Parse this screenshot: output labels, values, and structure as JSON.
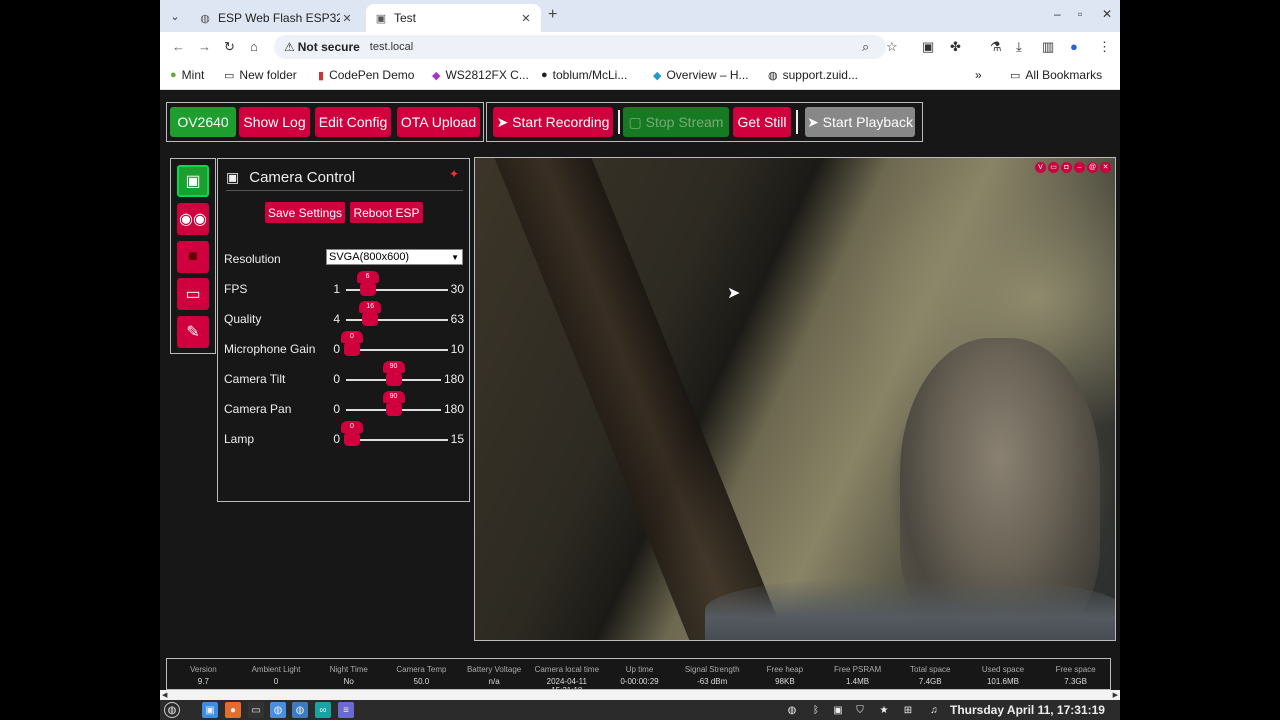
{
  "tabs": [
    {
      "title": "ESP Web Flash ESP32-"
    },
    {
      "title": "Test"
    }
  ],
  "omnibox": {
    "security": "Not secure",
    "url": "test.local"
  },
  "bookmarks": [
    "Mint",
    "New folder",
    "CodePen Demo",
    "WS2812FX C...",
    "toblum/McLi...",
    "Overview – H...",
    "support.zuid..."
  ],
  "bookmarks_all": "All Bookmarks",
  "toolbar": {
    "ov": "OV2640",
    "show_log": "Show Log",
    "edit_config": "Edit Config",
    "ota_upload": "OTA Upload",
    "start_recording": "➤ Start Recording",
    "stop_stream": "▢ Stop Stream",
    "get_still": "Get Still",
    "start_playback": "➤ Start Playback"
  },
  "sidebar_icons": [
    "camera-icon",
    "eyes-icon",
    "video-camera-icon",
    "monitor-icon",
    "wrench-icon"
  ],
  "panel": {
    "title": "Camera Control",
    "save": "Save Settings",
    "reboot": "Reboot ESP",
    "resolution_label": "Resolution",
    "resolution_value": "SVGA(800x600)",
    "sliders": [
      {
        "label": "FPS",
        "min": "1",
        "max": "30",
        "value": "6"
      },
      {
        "label": "Quality",
        "min": "4",
        "max": "63",
        "value": "16"
      },
      {
        "label": "Microphone Gain",
        "min": "0",
        "max": "10",
        "value": "0"
      },
      {
        "label": "Camera Tilt",
        "min": "0",
        "max": "180",
        "value": "90"
      },
      {
        "label": "Camera Pan",
        "min": "0",
        "max": "180",
        "value": "90"
      },
      {
        "label": "Lamp",
        "min": "0",
        "max": "15",
        "value": "0"
      }
    ]
  },
  "video_icons": [
    "V",
    "▭",
    "◘",
    "–",
    "@",
    "✕"
  ],
  "status": [
    {
      "label": "Version",
      "value": "9.7"
    },
    {
      "label": "Ambient Light",
      "value": "0"
    },
    {
      "label": "Night Time",
      "value": "No"
    },
    {
      "label": "Camera Temp",
      "value": "50.0"
    },
    {
      "label": "Battery Voltage",
      "value": "n/a"
    },
    {
      "label": "Camera local time",
      "value": "2024-04-11 15:31:18"
    },
    {
      "label": "Up time",
      "value": "0-00:00:29"
    },
    {
      "label": "Signal Strength",
      "value": "-63 dBm"
    },
    {
      "label": "Free heap",
      "value": "98KB"
    },
    {
      "label": "Free PSRAM",
      "value": "1.4MB"
    },
    {
      "label": "Total space",
      "value": "7.4GB"
    },
    {
      "label": "Used space",
      "value": "101.6MB"
    },
    {
      "label": "Free space",
      "value": "7.3GB"
    }
  ],
  "taskbar": {
    "clock": "Thursday April 11, 17:31:19"
  },
  "colors": {
    "accent": "#d0003f",
    "green": "#1e9e2e",
    "bg": "#171717"
  }
}
